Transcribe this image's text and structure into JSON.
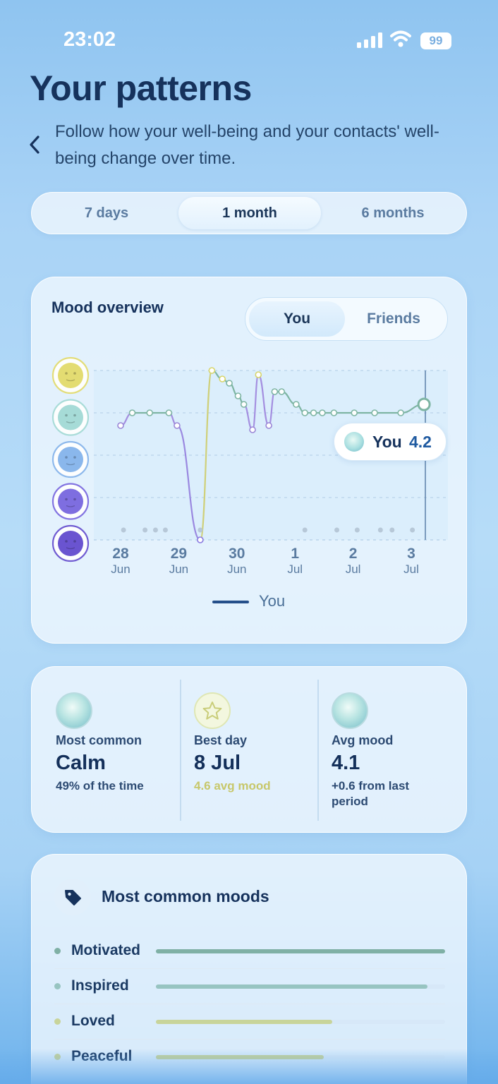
{
  "status_bar": {
    "time": "23:02",
    "battery": "99"
  },
  "header": {
    "title": "Your patterns",
    "subtitle": "Follow how your well-being and your contacts' well-being change over time."
  },
  "range_tabs": [
    {
      "label": "7 days",
      "active": false
    },
    {
      "label": "1 month",
      "active": true
    },
    {
      "label": "6 months",
      "active": false
    }
  ],
  "mood_overview": {
    "title": "Mood overview",
    "toggle": {
      "you": "You",
      "friends": "Friends",
      "active": "You"
    },
    "tooltip": {
      "label": "You",
      "value": "4.2"
    },
    "legend": "You",
    "face_colors": [
      "#e3dc72",
      "#a6dbd7",
      "#8ab7ec",
      "#7e6ee0",
      "#6a54d0"
    ]
  },
  "chart_data": {
    "type": "line",
    "x_tick_labels": [
      {
        "day": "28",
        "month": "Jun"
      },
      {
        "day": "29",
        "month": "Jun"
      },
      {
        "day": "30",
        "month": "Jun"
      },
      {
        "day": "1",
        "month": "Jul"
      },
      {
        "day": "2",
        "month": "Jul"
      },
      {
        "day": "3",
        "month": "Jul"
      }
    ],
    "ylim": [
      1,
      5
    ],
    "y_scale": "mood faces 1-5",
    "grid": true,
    "series": [
      {
        "name": "You",
        "x": [
          0.0,
          0.2,
          0.5,
          0.83,
          0.97,
          1.37,
          1.57,
          1.75,
          1.87,
          2.02,
          2.12,
          2.27,
          2.37,
          2.55,
          2.65,
          2.77,
          3.02,
          3.17,
          3.32,
          3.47,
          3.67,
          4.02,
          4.37,
          4.82,
          5.22
        ],
        "y": [
          3.7,
          4.0,
          4.0,
          4.0,
          3.7,
          1.0,
          5.0,
          4.8,
          4.7,
          4.4,
          4.2,
          3.6,
          4.9,
          3.7,
          4.5,
          4.5,
          4.2,
          4.0,
          4.0,
          4.0,
          4.0,
          4.0,
          4.0,
          4.0,
          4.2
        ]
      }
    ],
    "no_entry_markers_x": [
      0.05,
      0.42,
      0.6,
      0.77,
      1.37,
      3.17,
      3.72,
      4.07,
      4.47,
      4.67,
      5.02
    ]
  },
  "stats": [
    {
      "label": "Most common",
      "value": "Calm",
      "sub": "49% of the time",
      "icon": "calm-face-icon"
    },
    {
      "label": "Best day",
      "value": "8 Jul",
      "sub": "4.6 avg mood",
      "icon": "star-icon"
    },
    {
      "label": "Avg mood",
      "value": "4.1",
      "sub": "+0.6 from last period",
      "icon": "calm-face-icon"
    }
  ],
  "common_moods": {
    "title": "Most common moods",
    "items": [
      {
        "name": "Motivated",
        "share": 1.0,
        "color": "#7fb0a5"
      },
      {
        "name": "Inspired",
        "share": 0.94,
        "color": "#97c4c1"
      },
      {
        "name": "Loved",
        "share": 0.61,
        "color": "#c8d49a"
      },
      {
        "name": "Peaceful",
        "share": 0.58,
        "color": "#c6d29a"
      }
    ]
  }
}
